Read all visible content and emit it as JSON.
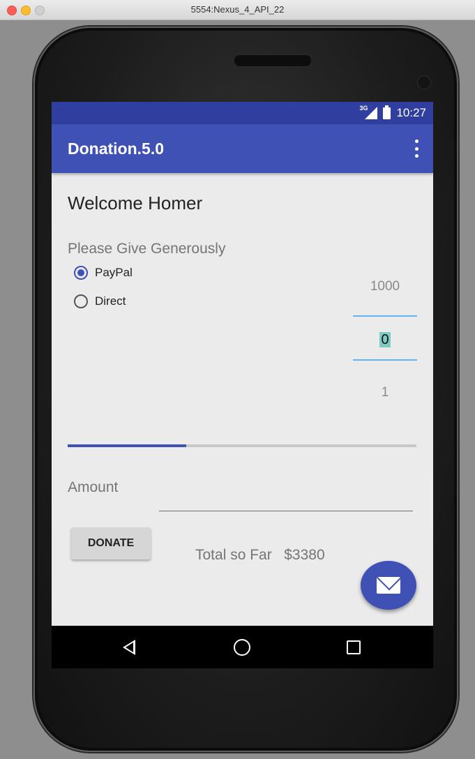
{
  "window": {
    "title": "5554:Nexus_4_API_22"
  },
  "status_bar": {
    "network": "3G",
    "time": "10:27"
  },
  "app_bar": {
    "title": "Donation.5.0",
    "overflow_icon": "more-vert-icon"
  },
  "main": {
    "welcome": "Welcome Homer",
    "prompt": "Please Give Generously",
    "payment_options": [
      {
        "label": "PayPal",
        "selected": true
      },
      {
        "label": "Direct",
        "selected": false
      }
    ],
    "amount_picker": {
      "above": "1000",
      "current": "0",
      "below": "1"
    },
    "progress": {
      "fraction": 0.34,
      "color": "#3f51b5"
    },
    "amount_label": "Amount",
    "amount_value": "",
    "donate_label": "DONATE",
    "total_label": "Total so Far",
    "total_value": "$3380",
    "fab_icon": "mail-icon"
  },
  "nav_bar": {
    "icons": [
      "back-icon",
      "home-icon",
      "recents-icon"
    ]
  },
  "colors": {
    "primary": "#3f51b5",
    "primary_dark": "#303f9f",
    "accent_line": "#64b5f6"
  }
}
